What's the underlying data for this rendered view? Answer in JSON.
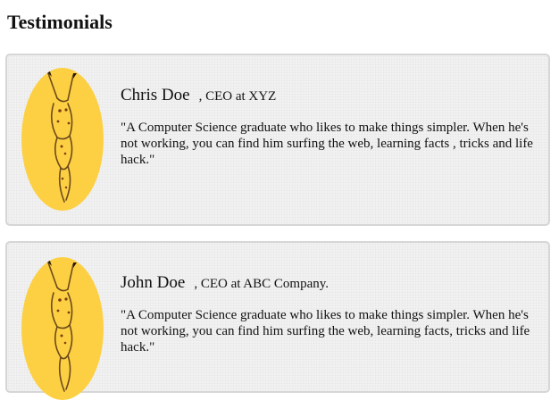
{
  "page": {
    "title": "Testimonials"
  },
  "testimonials": [
    {
      "name": "Chris Doe",
      "role": ", CEO at XYZ",
      "quote": "\"A Computer Science graduate who likes to make things simpler. When he's not working, you can find him surfing the web, learning facts , tricks and life hack.\"",
      "avatar_icon": "pikachu-avatar-icon"
    },
    {
      "name": "John Doe",
      "role": ", CEO at ABC Company.",
      "quote": "\"A Computer Science graduate who likes to make things simpler. When he's not working, you can find him surfing the web, learning facts, tricks and life hack.\"",
      "avatar_icon": "pikachu-avatar-icon"
    }
  ],
  "colors": {
    "avatar_background": "#fdd043",
    "card_background": "#f1f1f1",
    "card_border": "#d6d6d6"
  }
}
